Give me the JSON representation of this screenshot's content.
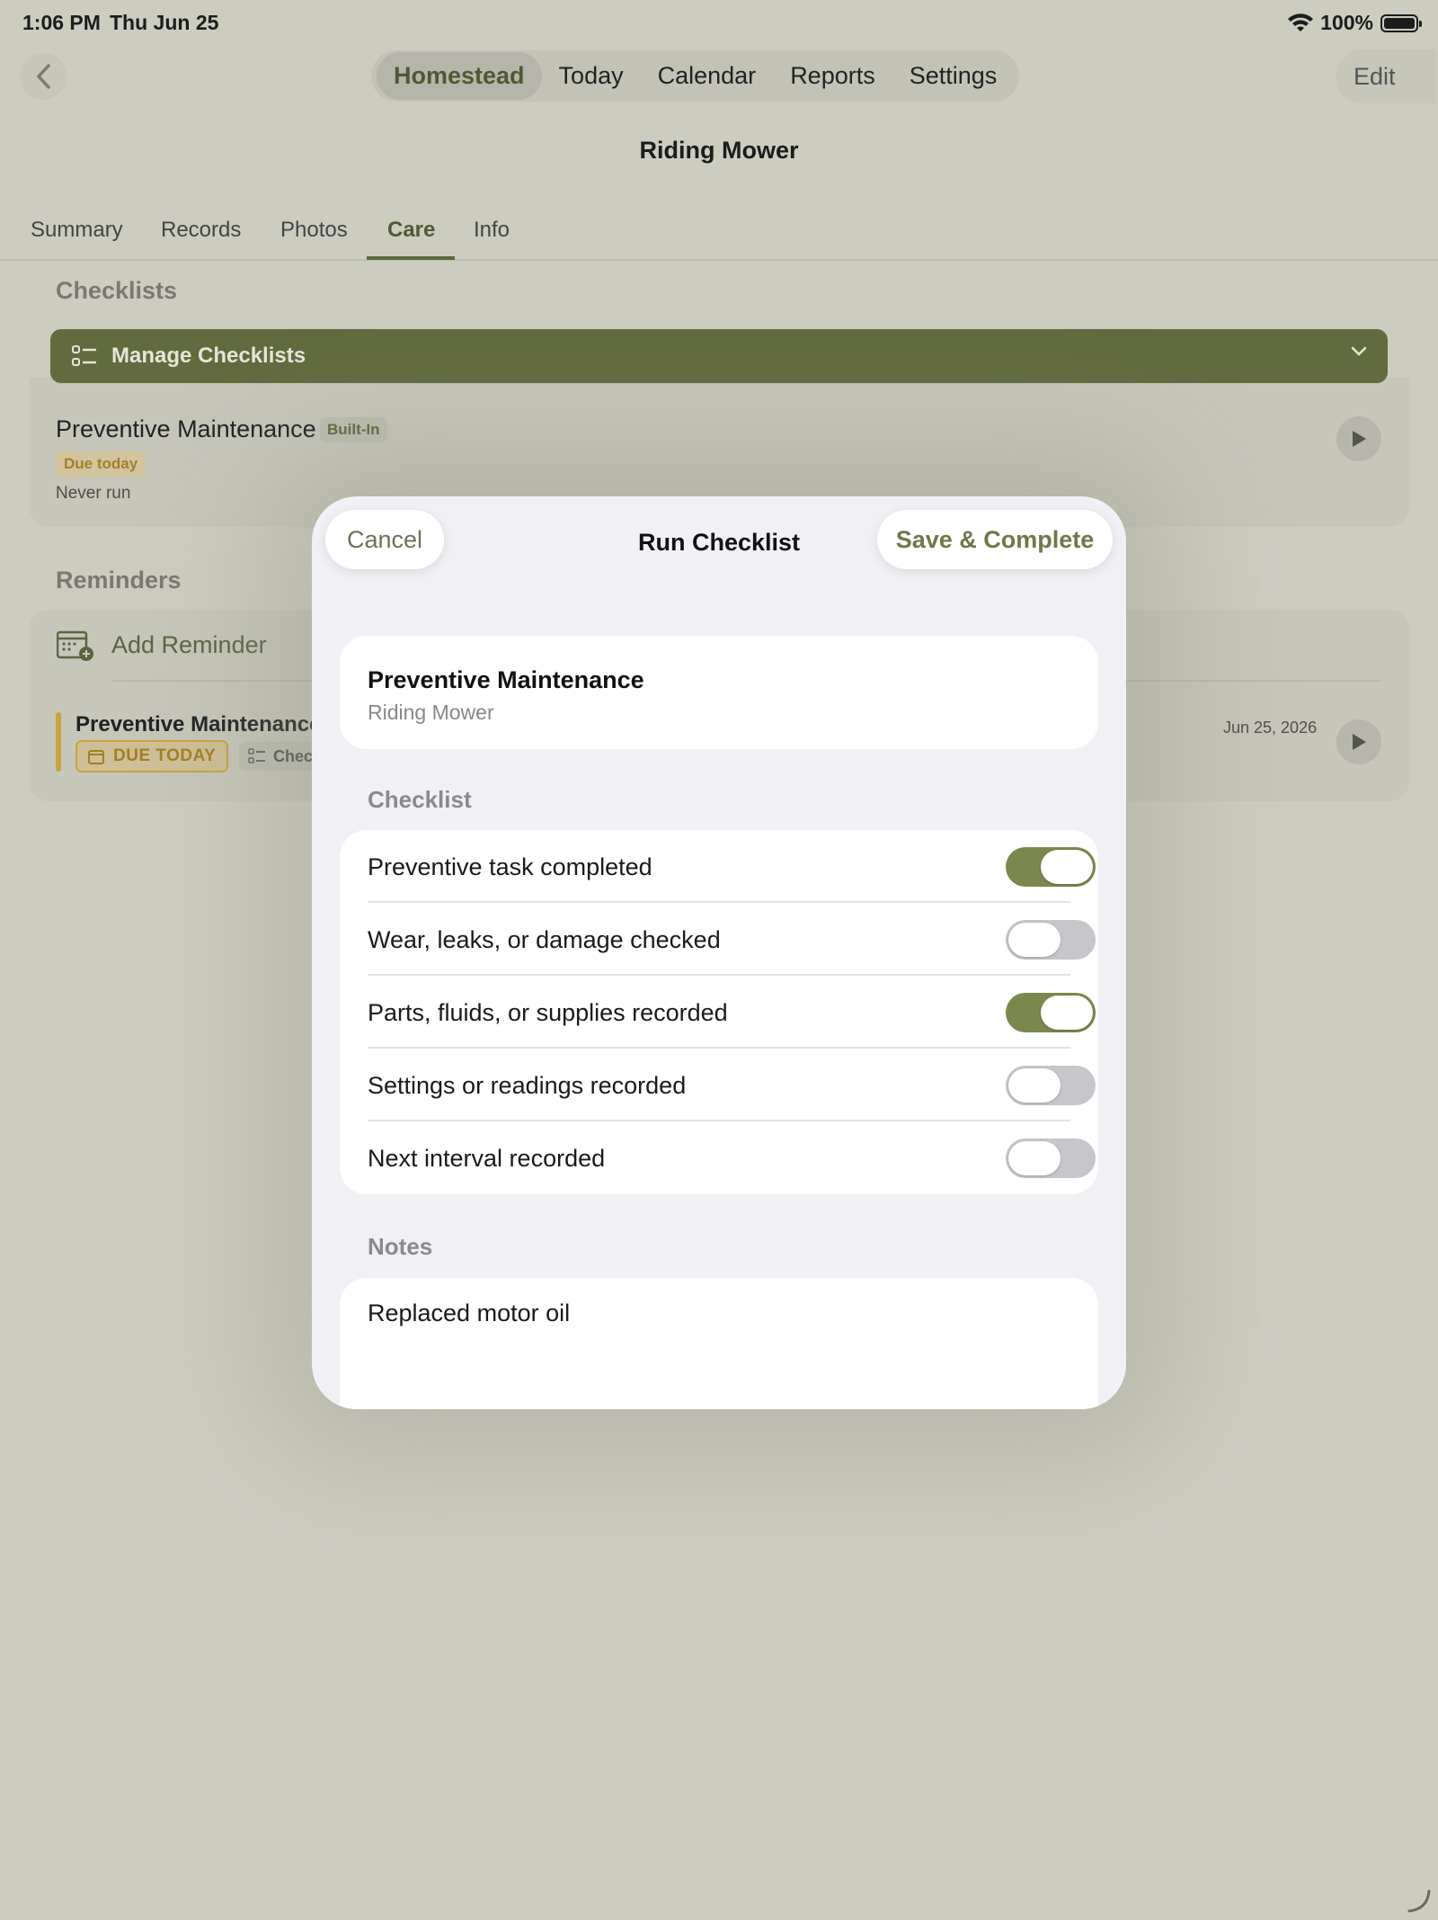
{
  "status_bar": {
    "time": "1:06 PM",
    "date": "Thu Jun 25",
    "battery": "100%"
  },
  "nav": {
    "tabs": [
      {
        "label": "Homestead",
        "active": true
      },
      {
        "label": "Today",
        "active": false
      },
      {
        "label": "Calendar",
        "active": false
      },
      {
        "label": "Reports",
        "active": false
      },
      {
        "label": "Settings",
        "active": false
      }
    ],
    "edit_label": "Edit"
  },
  "page_title": "Riding Mower",
  "sub_tabs": [
    "Summary",
    "Records",
    "Photos",
    "Care",
    "Info"
  ],
  "checklists": {
    "section_title": "Checklists",
    "manage_label": "Manage Checklists",
    "item": {
      "title": "Preventive Maintenance",
      "badge": "Built-In",
      "due": "Due today",
      "last_run": "Never run"
    }
  },
  "reminders": {
    "section_title": "Reminders",
    "add_label": "Add Reminder",
    "item": {
      "title": "Preventive Maintenance",
      "due_chip": "DUE TODAY",
      "check_chip": "Chec",
      "date": "Jun 25, 2026"
    }
  },
  "modal": {
    "title": "Run Checklist",
    "cancel_label": "Cancel",
    "save_label": "Save & Complete",
    "summary": {
      "title": "Preventive Maintenance",
      "subtitle": "Riding Mower"
    },
    "checklist_title": "Checklist",
    "items": [
      {
        "label": "Preventive task completed",
        "checked": true
      },
      {
        "label": "Wear, leaks, or damage checked",
        "checked": false
      },
      {
        "label": "Parts, fluids, or supplies recorded",
        "checked": true
      },
      {
        "label": "Settings or readings recorded",
        "checked": false
      },
      {
        "label": "Next interval recorded",
        "checked": false
      }
    ],
    "notes_title": "Notes",
    "notes_value": "Replaced motor oil"
  },
  "colors": {
    "accent": "#7b884d",
    "accent_dark": "#626b3f",
    "due": "#c8a43c"
  },
  "icons": [
    "chevron-left-icon",
    "wifi-icon",
    "battery-icon",
    "checklist-icon",
    "chevron-down-icon",
    "play-icon",
    "calendar-add-icon",
    "calendar-icon"
  ]
}
